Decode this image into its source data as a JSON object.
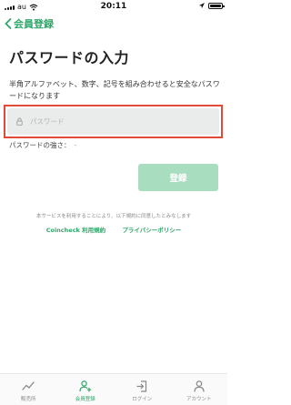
{
  "status_bar": {
    "carrier": "au",
    "time": "20:11"
  },
  "nav": {
    "back_label": "会員登録"
  },
  "page": {
    "title": "パスワードの入力",
    "instruction": "半角アルファベット、数字、記号を組み合わせると安全なパスワードになります"
  },
  "password_field": {
    "placeholder": "パスワード",
    "value": ""
  },
  "strength": {
    "label": "パスワードの強さ：",
    "value": "-"
  },
  "register_button": {
    "label": "登録"
  },
  "terms": {
    "note": "本サービスを利用することにより、以下規約に同意したとみなします",
    "terms_link": "Coincheck 利用規約",
    "privacy_link": "プライバシーポリシー"
  },
  "tab_bar": {
    "tabs": [
      {
        "label": "販売所",
        "icon": "chart-line-icon"
      },
      {
        "label": "会員登録",
        "icon": "add-user-icon"
      },
      {
        "label": "ログイン",
        "icon": "login-icon"
      },
      {
        "label": "アカウント",
        "icon": "account-icon"
      }
    ],
    "active_index": 1
  },
  "colors": {
    "accent": "#2fa56a",
    "button_disabled": "#a9ddc0",
    "highlight": "#e24a3a",
    "field_bg": "#e9eceb"
  }
}
